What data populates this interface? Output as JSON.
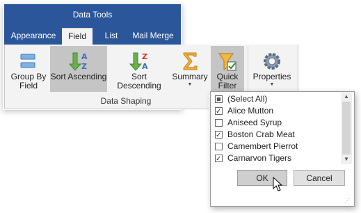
{
  "ribbon": {
    "title": "Data Tools",
    "tabs": [
      {
        "label": "Appearance"
      },
      {
        "label": "Field"
      },
      {
        "label": "List"
      },
      {
        "label": "Mail Merge"
      }
    ],
    "buttons": {
      "group_by": "Group By\nField",
      "sort_ascending": "Sort Ascending",
      "sort_descending": "Sort Descending",
      "summary": "Summary",
      "quick_filter": "Quick\nFilter",
      "properties": "Properties"
    },
    "group_label": "Data Shaping"
  },
  "filter_popup": {
    "items": [
      {
        "label": "(Select All)",
        "state": "partial"
      },
      {
        "label": "Alice Mutton",
        "state": "checked"
      },
      {
        "label": "Aniseed Syrup",
        "state": "unchecked"
      },
      {
        "label": "Boston Crab Meat",
        "state": "checked"
      },
      {
        "label": "Camembert Pierrot",
        "state": "unchecked"
      },
      {
        "label": "Carnarvon Tigers",
        "state": "checked"
      }
    ],
    "ok_label": "OK",
    "cancel_label": "Cancel"
  },
  "colors": {
    "accent": "#2b579a",
    "pressed": "#c5c5c5"
  }
}
